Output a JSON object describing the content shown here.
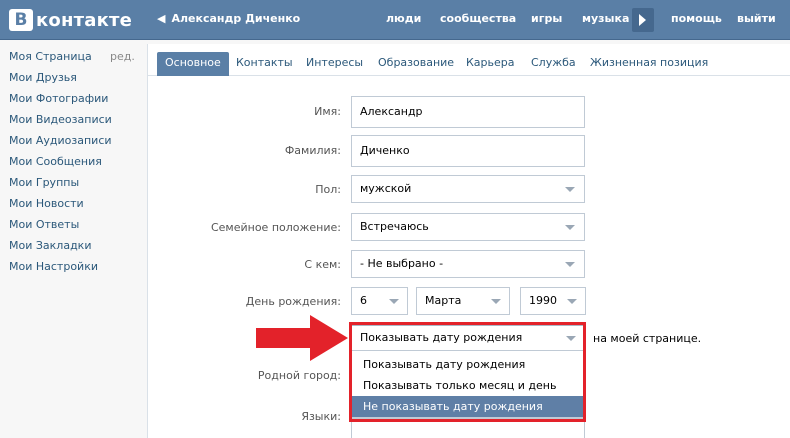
{
  "header": {
    "logo_letter": "В",
    "logo_text": "контакте",
    "back_user": "Александр Диченко",
    "nav": [
      "люди",
      "сообщества",
      "игры",
      "музыка",
      "помощь",
      "выйти"
    ]
  },
  "sidebar": {
    "edit_label": "ред.",
    "items": [
      "Моя Страница",
      "Мои Друзья",
      "Мои Фотографии",
      "Мои Видеозаписи",
      "Мои Аудиозаписи",
      "Мои Сообщения",
      "Мои Группы",
      "Мои Новости",
      "Мои Ответы",
      "Мои Закладки",
      "Мои Настройки"
    ]
  },
  "tabs": {
    "active_index": 0,
    "items": [
      "Основное",
      "Контакты",
      "Интересы",
      "Образование",
      "Карьера",
      "Служба",
      "Жизненная позиция"
    ]
  },
  "form": {
    "name": {
      "label": "Имя:",
      "value": "Александр"
    },
    "surname": {
      "label": "Фамилия:",
      "value": "Диченко"
    },
    "gender": {
      "label": "Пол:",
      "value": "мужской"
    },
    "family": {
      "label": "Семейное положение:",
      "value": "Встречаюсь"
    },
    "with_whom": {
      "label": "С кем:",
      "value": "- Не выбрано -"
    },
    "birthday": {
      "label": "День рождения:",
      "day": "6",
      "month": "Марта",
      "year": "1990"
    },
    "birthday_visibility": {
      "value": "Показывать дату рождения",
      "note": "на моей странице.",
      "options": [
        "Показывать дату рождения",
        "Показывать только месяц и день",
        "Не показывать дату рождения"
      ],
      "highlighted_option": 2
    },
    "hometown": {
      "label": "Родной город:"
    },
    "languages": {
      "label": "Языки:"
    }
  },
  "colors": {
    "header_bg": "#5a7fa6",
    "link": "#2b587a",
    "highlight_red": "#e3222a",
    "selected_option_bg": "#5f7fa6"
  }
}
